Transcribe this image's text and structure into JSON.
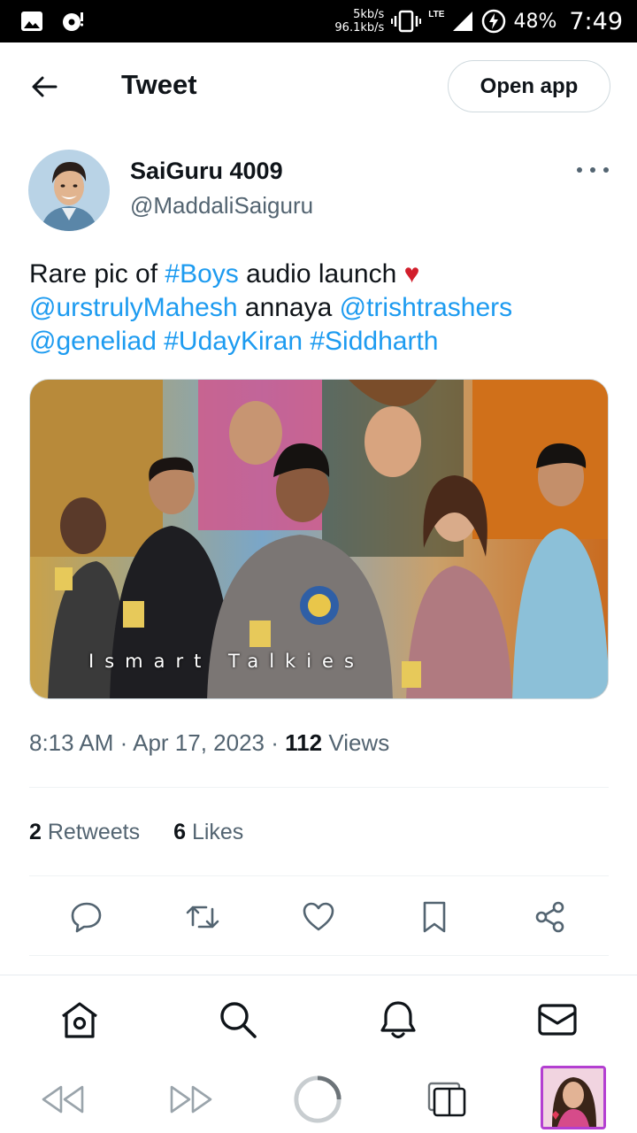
{
  "status_bar": {
    "speed_up": "5kb/s",
    "speed_down": "96.1kb/s",
    "network": "LTE",
    "battery": "48%",
    "time": "7:49"
  },
  "header": {
    "title": "Tweet",
    "open_app_label": "Open app"
  },
  "author": {
    "name": "SaiGuru 4009",
    "handle": "@MaddaliSaiguru"
  },
  "tweet": {
    "text_1": "Rare pic of ",
    "hashtag_boys": "#Boys",
    "text_2": " audio launch ",
    "heart": "♥",
    "mention_mahesh": "@urstrulyMahesh",
    "text_3": " annaya ",
    "mention_trish": "@trishtrashers",
    "mention_genelia": "@geneliad",
    "hashtag_uday": "#UdayKiran",
    "hashtag_sid": "#Siddharth",
    "image_watermark": "Ismart Talkies"
  },
  "meta": {
    "time": "8:13 AM",
    "separator": "·",
    "date": "Apr 17, 2023",
    "views_count": "112",
    "views_label": "Views"
  },
  "stats": {
    "retweets_count": "2",
    "retweets_label": "Retweets",
    "likes_count": "6",
    "likes_label": "Likes"
  },
  "colors": {
    "link": "#1d9bf0",
    "secondary_text": "#536471",
    "border": "#cfd9de"
  }
}
